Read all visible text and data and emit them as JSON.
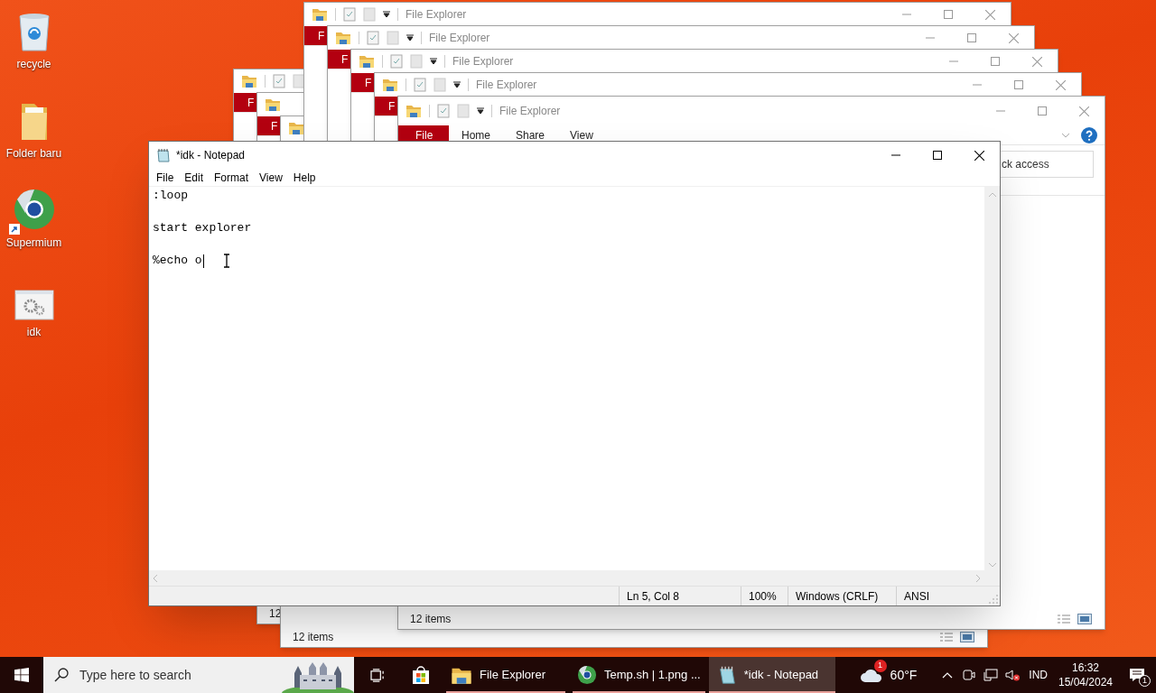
{
  "desktop_icons": [
    {
      "kind": "recycle",
      "label": "recycle",
      "shortcut": false
    },
    {
      "kind": "folder",
      "label": "Folder baru",
      "shortcut": false
    },
    {
      "kind": "browser",
      "label": "Supermium",
      "shortcut": true
    },
    {
      "kind": "settings-file",
      "label": "idk",
      "shortcut": false
    }
  ],
  "explorer_windows": [
    {
      "file_tab": "F"
    },
    {
      "file_tab": "F",
      "status": "12"
    },
    {
      "status": "12 items"
    },
    {
      "title": "File Explorer",
      "file_tab": "F"
    },
    {
      "title": "File Explorer",
      "file_tab": "F"
    },
    {
      "title": "File Explorer",
      "file_tab": "F"
    },
    {
      "title": "File Explorer",
      "file_tab": "F"
    },
    {
      "title": "File Explorer",
      "file_tab": "File",
      "ribbon_tabs": [
        "Home",
        "Share",
        "View"
      ],
      "address": "ck access",
      "status": "12 items"
    }
  ],
  "notepad": {
    "title": "*idk - Notepad",
    "menu": [
      "File",
      "Edit",
      "Format",
      "View",
      "Help"
    ],
    "text": ":loop\n\nstart explorer\n\n%echo o",
    "status": [
      "Ln 5, Col 8",
      "100%",
      "Windows (CRLF)",
      "ANSI"
    ]
  },
  "taskbar": {
    "search_placeholder": "Type here to search",
    "apps": [
      {
        "kind": "store",
        "running": false,
        "selected": false
      },
      {
        "kind": "explorer",
        "label": "File Explorer",
        "running": true,
        "selected": false
      },
      {
        "kind": "browser",
        "label": "Temp.sh | 1.png ...",
        "running": true,
        "selected": false
      },
      {
        "kind": "notepad",
        "label": "*idk - Notepad",
        "running": true,
        "selected": true
      }
    ],
    "weather": {
      "temperature": "60°F",
      "badge": "1"
    },
    "tray": {
      "muted": true,
      "language": "IND",
      "time": "16:32",
      "date": "15/04/2024",
      "notifications": "1"
    }
  }
}
